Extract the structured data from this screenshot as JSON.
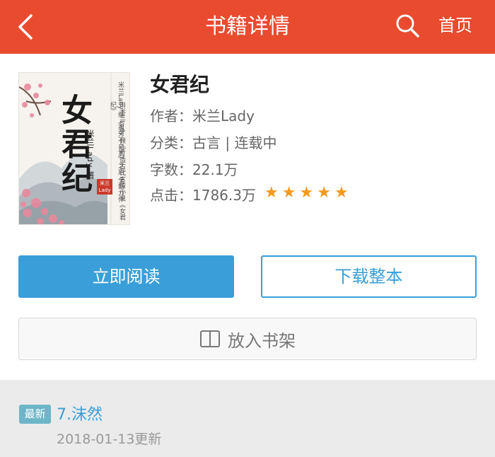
{
  "header": {
    "title": "书籍详情",
    "home_label": "首页",
    "bg_color": "#e84b2e"
  },
  "book": {
    "title": "女君纪",
    "author_line": "作者：米兰Lady",
    "category_line": "分类：古言 | 连载中",
    "words_line": "字数：22.1万",
    "clicks_line": "点击：1786.3万",
    "rating": 5,
    "cover": {
      "title": "女君纪",
      "author": "米兰Lady 著",
      "seal": "米兰Lady",
      "side_text": "米兰Lady 继《孤芳不自赏》之后 全新力作",
      "side_text2": "由米兰Lady 倾心打造古代言情小说《女君纪》"
    }
  },
  "actions": {
    "read_label": "立即阅读",
    "download_label": "下载整本",
    "shelf_label": "放入书架",
    "accent_color": "#3a9fd9"
  },
  "latest": {
    "badge": "最新",
    "chapter": "7.沫然",
    "update": "2018-01-13更新"
  }
}
